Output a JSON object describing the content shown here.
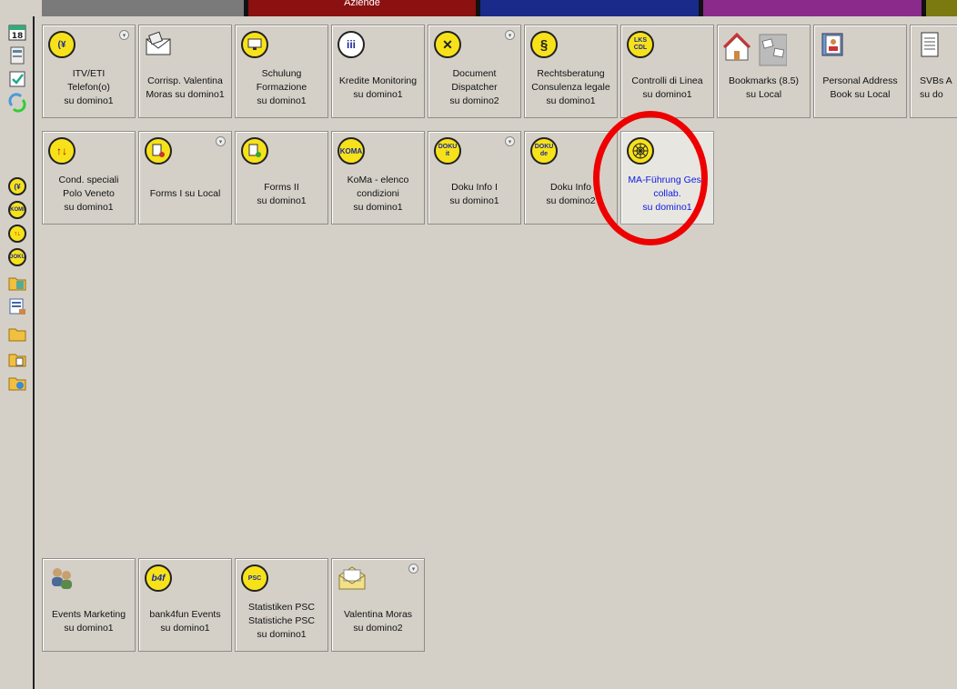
{
  "top_tabs": [
    {
      "label": "",
      "color": "#7a7a7a"
    },
    {
      "label": "Aziende",
      "color": "#8b1010"
    },
    {
      "label": "",
      "color": "#1a2a8a"
    },
    {
      "label": "",
      "color": "#8a2a8a"
    },
    {
      "label": "",
      "color": "#7a7a10"
    }
  ],
  "left_icons": [
    "calendar-icon",
    "address-book-icon",
    "todo-icon",
    "replicate-icon",
    "itv-icon",
    "koma-icon",
    "cond-icon",
    "doku-icon",
    "bookmark-folder-icon",
    "forms-icon",
    "folder-icon",
    "folder-doc-icon",
    "folder-web-icon"
  ],
  "row1": [
    {
      "lines": [
        "ITV/ETI",
        "Telefon(o)",
        "su domino1"
      ],
      "icon": "yen-icon",
      "dropdown": true
    },
    {
      "lines": [
        "Corrisp. Valentina",
        "Moras su domino1"
      ],
      "icon": "envelope-icon",
      "dropdown": false
    },
    {
      "lines": [
        "Schulung",
        "Formazione",
        "su domino1"
      ],
      "icon": "training-icon",
      "dropdown": false
    },
    {
      "lines": [
        "Kredite Monitoring",
        "su domino1"
      ],
      "icon": "iii-icon",
      "dropdown": false
    },
    {
      "lines": [
        "Document",
        "Dispatcher",
        "su domino2"
      ],
      "icon": "dispatcher-icon",
      "dropdown": true
    },
    {
      "lines": [
        "Rechtsberatung",
        "Consulenza legale",
        "su domino1"
      ],
      "icon": "paragraph-icon",
      "dropdown": false
    },
    {
      "lines": [
        "Controlli di Linea",
        "su domino1"
      ],
      "icon": "lks-icon",
      "dropdown": false
    },
    {
      "lines": [
        "Bookmarks (8.5)",
        "su Local"
      ],
      "icon": "home-icon",
      "dropdown": false
    },
    {
      "lines": [
        "Personal Address",
        "Book su Local"
      ],
      "icon": "address-icon",
      "dropdown": false
    },
    {
      "lines": [
        "SVBs A",
        "su do"
      ],
      "icon": "notepad-icon",
      "dropdown": false
    }
  ],
  "row2": [
    {
      "lines": [
        "Cond. speciali",
        "Polo Veneto",
        "su domino1"
      ],
      "icon": "cond-icon",
      "dropdown": false
    },
    {
      "lines": [
        "Forms I su Local"
      ],
      "icon": "forms-icon",
      "dropdown": true
    },
    {
      "lines": [
        "Forms II",
        "su domino1"
      ],
      "icon": "forms2-icon",
      "dropdown": false
    },
    {
      "lines": [
        "KoMa - elenco",
        "condizioni",
        "su domino1"
      ],
      "icon": "koma-icon",
      "dropdown": false
    },
    {
      "lines": [
        "Doku Info I",
        "su domino1"
      ],
      "icon": "doku-it-icon",
      "dropdown": true
    },
    {
      "lines": [
        "Doku Info",
        "su domino2"
      ],
      "icon": "doku-de-icon",
      "dropdown": false
    },
    {
      "lines": [
        "MA-Führung Gest.",
        "collab.",
        "su domino1"
      ],
      "icon": "web-icon",
      "dropdown": false,
      "selected": true
    }
  ],
  "row3": [
    {
      "lines": [
        "Events Marketing",
        "su domino1"
      ],
      "icon": "people-icon",
      "dropdown": false
    },
    {
      "lines": [
        "bank4fun Events",
        "su domino1"
      ],
      "icon": "b4f-icon",
      "dropdown": false
    },
    {
      "lines": [
        "Statistiken PSC",
        "Statistiche PSC",
        "su domino1"
      ],
      "icon": "psc-icon",
      "dropdown": false
    },
    {
      "lines": [
        "Valentina Moras",
        "su domino2"
      ],
      "icon": "mail-open-icon",
      "dropdown": true
    }
  ]
}
